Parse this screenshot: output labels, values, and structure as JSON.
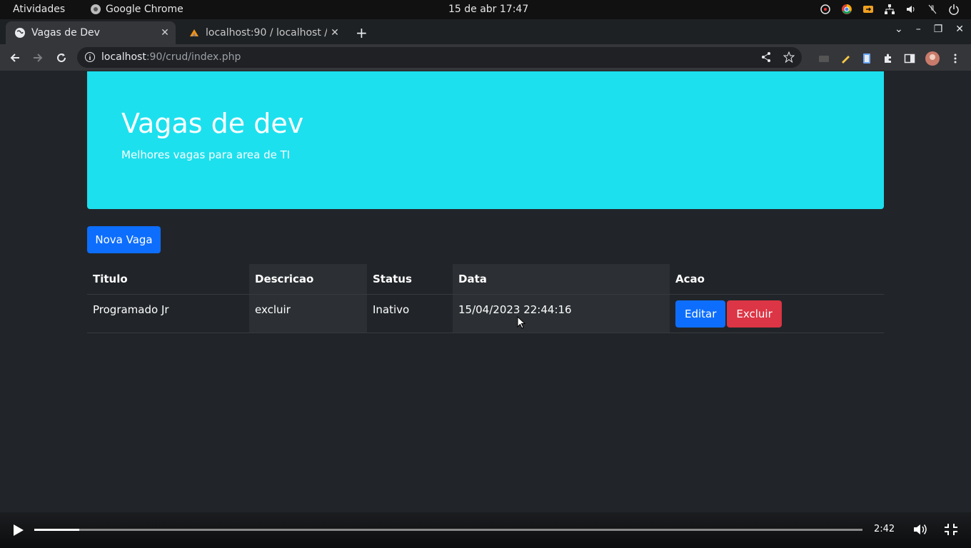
{
  "system": {
    "activities": "Atividades",
    "app_name": "Google Chrome",
    "clock": "15 de abr  17:47"
  },
  "browser": {
    "tabs": [
      {
        "title": "Vagas de Dev",
        "active": true
      },
      {
        "title": "localhost:90 / localhost /",
        "active": false
      }
    ],
    "url_host": "localhost",
    "url_rest": ":90/crud/index.php"
  },
  "page": {
    "jumbotron": {
      "title": "Vagas de dev",
      "subtitle": "Melhores vagas para area de TI"
    },
    "new_button": "Nova Vaga",
    "table": {
      "headers": [
        "Titulo",
        "Descricao",
        "Status",
        "Data",
        "Acao"
      ],
      "rows": [
        {
          "titulo": "Programado Jr",
          "descricao": "excluir",
          "status": "Inativo",
          "data": "15/04/2023 22:44:16",
          "edit": "Editar",
          "delete": "Excluir"
        }
      ]
    }
  },
  "video": {
    "time": "2:42",
    "progress_fraction": 0.054
  },
  "colors": {
    "jumbotron": "#1de0ee",
    "primary": "#0d6efd",
    "danger": "#dc3545",
    "background": "#212529"
  }
}
